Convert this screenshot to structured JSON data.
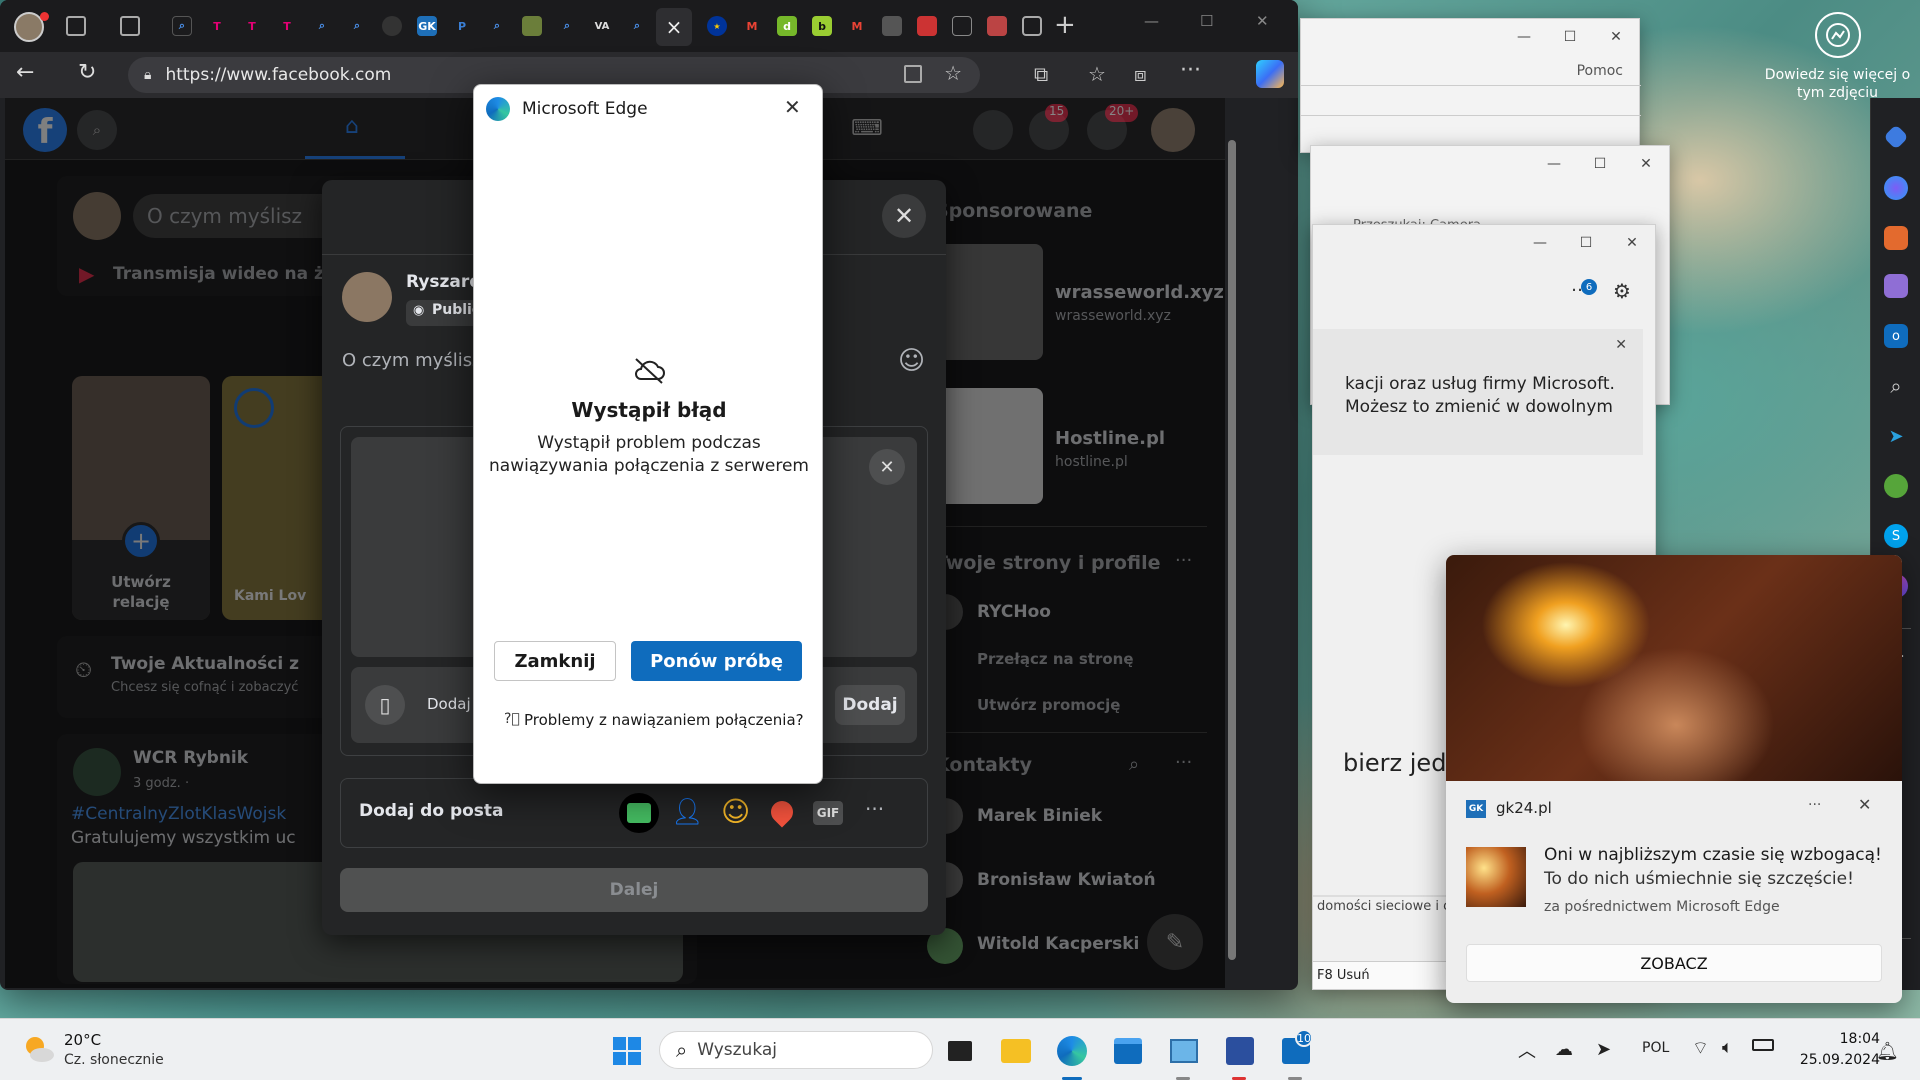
{
  "desktop": {
    "photo_info_label": "Dowiedz się więcej o tym zdjęciu"
  },
  "bg_windows": {
    "win1": {
      "menu_help": "Pomoc"
    },
    "win2": {
      "title_partial": "Przeszukaj: Camera"
    },
    "win3": {
      "badge": "6",
      "notice_line1": "kacji oraz usług firmy Microsoft.",
      "notice_line2": "Możesz to zmienić w dowolnym",
      "heading_partial": "bierz jedn",
      "footer_partial": "domości sieciowe i c",
      "f8_label": "F8 Usuń"
    }
  },
  "browser": {
    "url": "https://www.facebook.com",
    "tab_labels": [
      "GK",
      "VA"
    ],
    "close_tab_glyph": "×"
  },
  "facebook": {
    "messenger_badge": "15",
    "notifications_badge": "20+",
    "whats_on_mind": "O czym myślisz",
    "live_video": "Transmisja wideo na żywo",
    "create_story": "Utwórz relację",
    "story_name": "Kami Lov",
    "memories_title": "Twoje Aktualności z",
    "memories_sub": "Chcesz się cofnąć i zobaczyć",
    "post_author": "WCR Rybnik",
    "post_time": "3 godz. · ",
    "post_hashtag": "#CentralnyZlotKlasWojsk",
    "post_text": "Gratulujemy wszystkim uc",
    "sponsored": "Sponsorowane",
    "ad1_title": "wrasseworld.xyz",
    "ad1_domain": "wrasseworld.xyz",
    "ad2_title": "Hostline.pl",
    "ad2_domain": "hostline.pl",
    "pages_title": "Twoje strony i profile",
    "page_name": "RYCHoo",
    "switch_page": "Przełącz na stronę",
    "create_promo": "Utwórz promocję",
    "contacts": "Kontakty",
    "contact1": "Marek Biniek",
    "contact2": "Bronisław Kwiatoń",
    "contact3": "Witold Kacperski"
  },
  "composer": {
    "author": "Ryszard W",
    "audience": "Publiczn",
    "placeholder": "O czym myślisz, Ry",
    "add_from_mobile": "Dodaj zd",
    "add_button": "Dodaj",
    "add_to_post": "Dodaj do posta",
    "gif": "GIF",
    "next": "Dalej"
  },
  "dialog": {
    "title": "Microsoft Edge",
    "error_title": "Wystąpił błąd",
    "error_msg_line1": "Wystąpił problem podczas",
    "error_msg_line2": "nawiązywania połączenia z serwerem",
    "close_btn": "Zamknij",
    "retry_btn": "Ponów próbę",
    "help_link": "Problemy z nawiązaniem połączenia?"
  },
  "notification": {
    "site": "gk24.pl",
    "site_icon_text": "GK",
    "more": "···",
    "title": "Oni w najbliższym czasie się wzbogacą!",
    "body": "To do nich uśmiechnie się szczęście!",
    "via": "za pośrednictwem Microsoft Edge",
    "action": "ZOBACZ"
  },
  "taskbar": {
    "temp": "20°C",
    "weather": "Cz. słonecznie",
    "search_placeholder": "Wyszukaj",
    "lang": "POL",
    "time": "18:04",
    "date": "25.09.2024",
    "store_badge": "10"
  },
  "colors": {
    "accent": "#0f6cbd",
    "fb_blue": "#1877f2",
    "fb_dark": "#242526"
  }
}
